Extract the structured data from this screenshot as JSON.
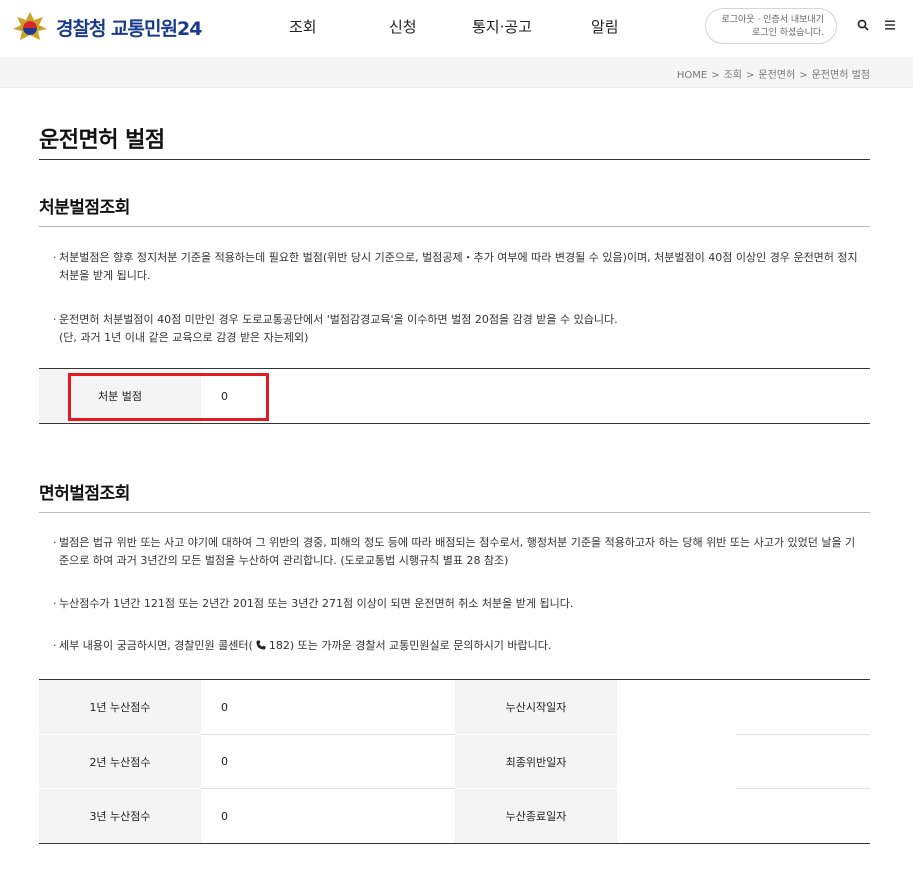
{
  "header": {
    "logo_text": "경찰청 교통민원24",
    "nav": [
      "조회",
      "신청",
      "통지·공고",
      "알림"
    ],
    "login_line1": "로그아웃 · 인증서 내보내기",
    "login_line2": "로그인 하셨습니다.",
    "icons": [
      "search-icon",
      "menu-icon"
    ]
  },
  "breadcrumb": [
    "HOME",
    "조회",
    "운전면허",
    "운전면허 벌점"
  ],
  "page": {
    "title": "운전면허 벌점"
  },
  "section1": {
    "title": "처분벌점조회",
    "bullets": [
      "처분벌점은 향후 정지처분 기준을 적용하는데 필요한 벌점(위반 당시 기준으로, 벌점공제・추가 여부에 따라 변경될 수 있음)이며, 처분벌점이 40점 이상인 경우 운전면허 정지처분을 받게 됩니다.",
      "운전면허 처분벌점이 40점 미만인 경우 도로교통공단에서 '벌점감경교육'을 이수하면 벌점 20점을 감경 받을 수 있습니다.",
      "(단, 과거 1년 이내 같은 교육으로 감경 받은 자는제외)"
    ],
    "table": {
      "label": "처분 벌점",
      "value": "0"
    }
  },
  "section2": {
    "title": "면허벌점조회",
    "bullets": [
      "벌점은 법규 위반 또는 사고 야기에 대하여 그 위반의 경중, 피해의 정도 등에 따라 배점되는 점수로서, 행정처분 기준을 적용하고자 하는 당해 위반 또는 사고가 있었던 날을 기준으로 하여 과거 3년간의 모든 벌점을 누산하여 관리합니다. (도로교통법 시행규칙 별표 28 참조)",
      "누산점수가 1년간 121점 또는 2년간 201점 또는 3년간 271점 이상이 되면 운전면허 취소 처분을 받게 됩니다.",
      "세부 내용이 궁금하시면, 경찰민원 콜센터(",
      "182) 또는 가까운 경찰서 교통민원실로 문의하시기 바랍니다."
    ],
    "rows": [
      {
        "label": "1년 누산점수",
        "value": "0",
        "label2": "누산시작일자",
        "value2": ""
      },
      {
        "label": "2년 누산점수",
        "value": "0",
        "label2": "최종위반일자",
        "value2": ""
      },
      {
        "label": "3년 누산점수",
        "value": "0",
        "label2": "누산종료일자",
        "value2": ""
      }
    ]
  },
  "colors": {
    "brand": "#1a3a8e",
    "highlight": "#e01b24"
  }
}
